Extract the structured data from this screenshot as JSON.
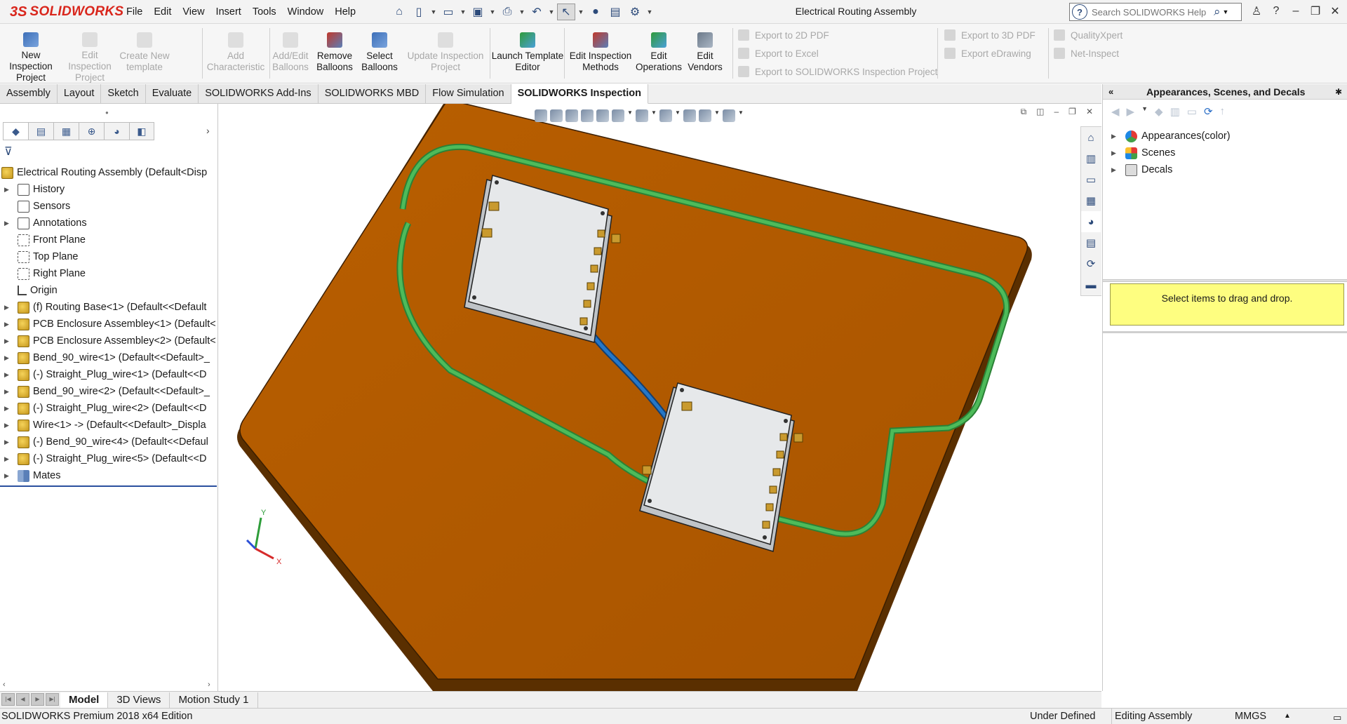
{
  "app": {
    "brand": "SOLIDWORKS",
    "brand_prefix": "3S",
    "window_title": "Electrical Routing Assembly"
  },
  "menu": [
    "File",
    "Edit",
    "View",
    "Insert",
    "Tools",
    "Window",
    "Help"
  ],
  "search": {
    "placeholder": "Search SOLIDWORKS Help"
  },
  "commands": [
    {
      "label": "New Inspection Project",
      "enabled": true
    },
    {
      "label": "Edit Inspection Project",
      "enabled": false
    },
    {
      "label": "Create New template",
      "enabled": false
    },
    {
      "label": "Add Characteristic",
      "enabled": false
    },
    {
      "label": "Add/Edit Balloons",
      "enabled": false
    },
    {
      "label": "Remove Balloons",
      "enabled": true
    },
    {
      "label": "Select Balloons",
      "enabled": true
    },
    {
      "label": "Update Inspection Project",
      "enabled": false
    },
    {
      "label": "Launch Template Editor",
      "enabled": true
    },
    {
      "label": "Edit Inspection Methods",
      "enabled": true
    },
    {
      "label": "Edit Operations",
      "enabled": true
    },
    {
      "label": "Edit Vendors",
      "enabled": true
    }
  ],
  "exports": {
    "col1": [
      "Export to 2D PDF",
      "Export to Excel",
      "Export to SOLIDWORKS Inspection Project"
    ],
    "col2": [
      "Export to 3D PDF",
      "Export eDrawing"
    ],
    "col3": [
      "QualityXpert",
      "Net-Inspect"
    ]
  },
  "cm_tabs": [
    "Assembly",
    "Layout",
    "Sketch",
    "Evaluate",
    "SOLIDWORKS Add-Ins",
    "SOLIDWORKS MBD",
    "Flow Simulation",
    "SOLIDWORKS Inspection"
  ],
  "cm_tab_active": "SOLIDWORKS Inspection",
  "tree": [
    {
      "label": "Electrical Routing Assembly  (Default<Disp",
      "icon": "asm",
      "expander": "",
      "root": true
    },
    {
      "label": "History",
      "icon": "fold",
      "expander": "▶"
    },
    {
      "label": "Sensors",
      "icon": "fold",
      "expander": ""
    },
    {
      "label": "Annotations",
      "icon": "fold",
      "expander": "▶"
    },
    {
      "label": "Front Plane",
      "icon": "plane",
      "expander": ""
    },
    {
      "label": "Top Plane",
      "icon": "plane",
      "expander": ""
    },
    {
      "label": "Right Plane",
      "icon": "plane",
      "expander": ""
    },
    {
      "label": "Origin",
      "icon": "origin",
      "expander": ""
    },
    {
      "label": "(f) Routing Base<1> (Default<<Default",
      "icon": "asm",
      "expander": "▶"
    },
    {
      "label": "PCB Enclosure Assembley<1> (Default<",
      "icon": "asm",
      "expander": "▶"
    },
    {
      "label": "PCB Enclosure Assembley<2> (Default<",
      "icon": "asm",
      "expander": "▶"
    },
    {
      "label": "Bend_90_wire<1> (Default<<Default>_",
      "icon": "asm",
      "expander": "▶"
    },
    {
      "label": "(-) Straight_Plug_wire<1> (Default<<D",
      "icon": "asm",
      "expander": "▶"
    },
    {
      "label": "Bend_90_wire<2> (Default<<Default>_",
      "icon": "asm",
      "expander": "▶"
    },
    {
      "label": "(-) Straight_Plug_wire<2> (Default<<D",
      "icon": "asm",
      "expander": "▶"
    },
    {
      "label": "Wire<1> -> (Default<<Default>_Displa",
      "icon": "asm",
      "expander": "▶"
    },
    {
      "label": "(-) Bend_90_wire<4> (Default<<Defaul",
      "icon": "asm",
      "expander": "▶"
    },
    {
      "label": "(-) Straight_Plug_wire<5> (Default<<D",
      "icon": "asm",
      "expander": "▶"
    },
    {
      "label": "Mates",
      "icon": "mates",
      "expander": "▶"
    }
  ],
  "taskpane": {
    "title": "Appearances, Scenes, and Decals",
    "items": [
      "Appearances(color)",
      "Scenes",
      "Decals"
    ],
    "hint": "Select items to drag and drop."
  },
  "bottom_tabs": [
    "Model",
    "3D Views",
    "Motion Study 1"
  ],
  "bottom_tab_active": "Model",
  "status": {
    "edition": "SOLIDWORKS Premium 2018 x64 Edition",
    "defined": "Under Defined",
    "editing": "Editing Assembly",
    "units": "MMGS"
  },
  "axes": {
    "x": "X",
    "y": "Y"
  },
  "colors": {
    "base_plate": "#b25b00",
    "wire_green": "#3aa84a",
    "wire_blue": "#1f63a8",
    "enclosure": "#e4e6e8",
    "brand": "#d9261c"
  }
}
